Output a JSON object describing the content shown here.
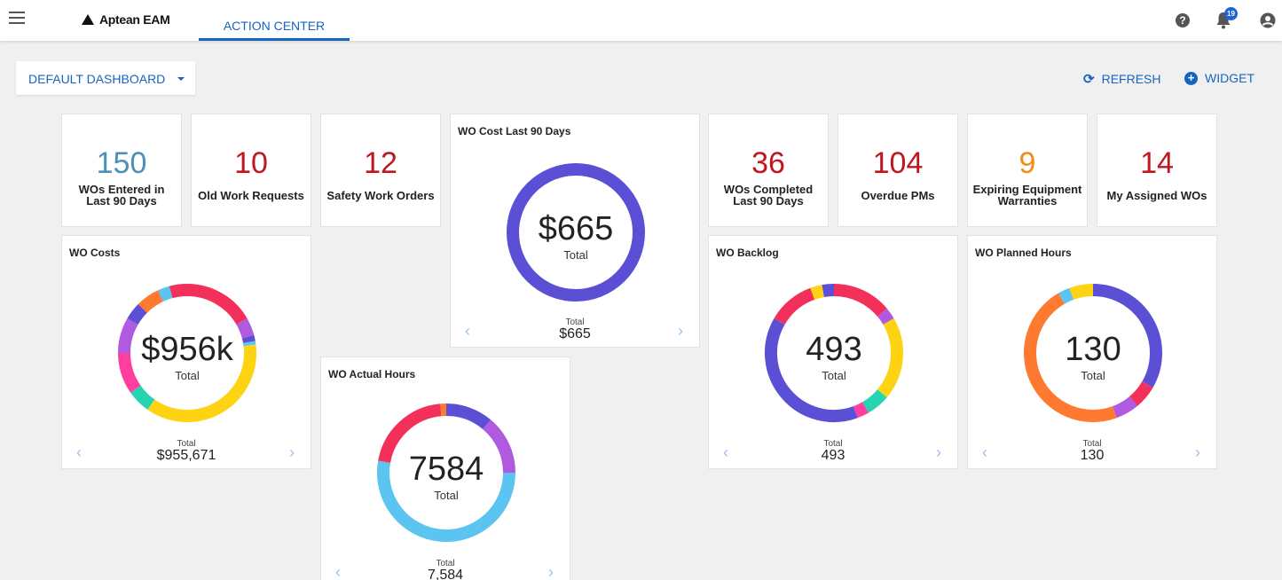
{
  "header": {
    "brand": "Aptean EAM",
    "tab": "ACTION CENTER",
    "notifications_count": "19",
    "help_glyph": "?",
    "icons": [
      "menu-icon",
      "help-icon",
      "bell-icon",
      "user-icon"
    ]
  },
  "toolbar": {
    "dashboard": "DEFAULT DASHBOARD",
    "refresh": "REFRESH",
    "widget": "WIDGET",
    "plus_glyph": "+",
    "refresh_glyph": "⟳"
  },
  "kpis": [
    {
      "value": "150",
      "label_1": "WOs Entered in",
      "label_2": "Last 90 Days",
      "color": "#4a90b8"
    },
    {
      "value": "10",
      "label_1": "Old Work Requests",
      "color": "#c0161f"
    },
    {
      "value": "12",
      "label_1": "Safety Work Orders",
      "color": "#c0161f"
    },
    {
      "value": "36",
      "label_1": "WOs Completed",
      "label_2": "Last 90 Days",
      "color": "#c0161f"
    },
    {
      "value": "104",
      "label_1": "Overdue PMs",
      "color": "#c0161f"
    },
    {
      "value": "9",
      "label_1": "Expiring Equipment",
      "label_2": "Warranties",
      "color": "#f28c12"
    },
    {
      "value": "14",
      "label_1": "My Assigned WOs",
      "color": "#c0161f"
    }
  ],
  "widgets": {
    "cost90": {
      "title": "WO Cost Last 90 Days",
      "center": "$665",
      "center_label": "Total",
      "foot_label": "Total",
      "foot_value": "$665"
    },
    "costs": {
      "title": "WO Costs",
      "center": "$956k",
      "center_label": "Total",
      "foot_label": "Total",
      "foot_value": "$955,671"
    },
    "actual": {
      "title": "WO Actual Hours",
      "center": "7584",
      "center_label": "Total",
      "foot_label": "Total",
      "foot_value": "7,584"
    },
    "backlog": {
      "title": "WO Backlog",
      "center": "493",
      "center_label": "Total",
      "foot_label": "Total",
      "foot_value": "493"
    },
    "planned": {
      "title": "WO Planned Hours",
      "center": "130",
      "center_label": "Total",
      "foot_label": "Total",
      "foot_value": "130"
    },
    "nav_prev": "‹",
    "nav_next": "›"
  },
  "colors": {
    "accent": "#1565c0",
    "indigo": "#5b4fd6",
    "red": "#f2305a",
    "yellow": "#fdd314",
    "sky": "#5bc4f0",
    "orange": "#ff7a30",
    "purple": "#b05ae0",
    "teal": "#27d4b0",
    "pink": "#ff3fa0"
  }
}
